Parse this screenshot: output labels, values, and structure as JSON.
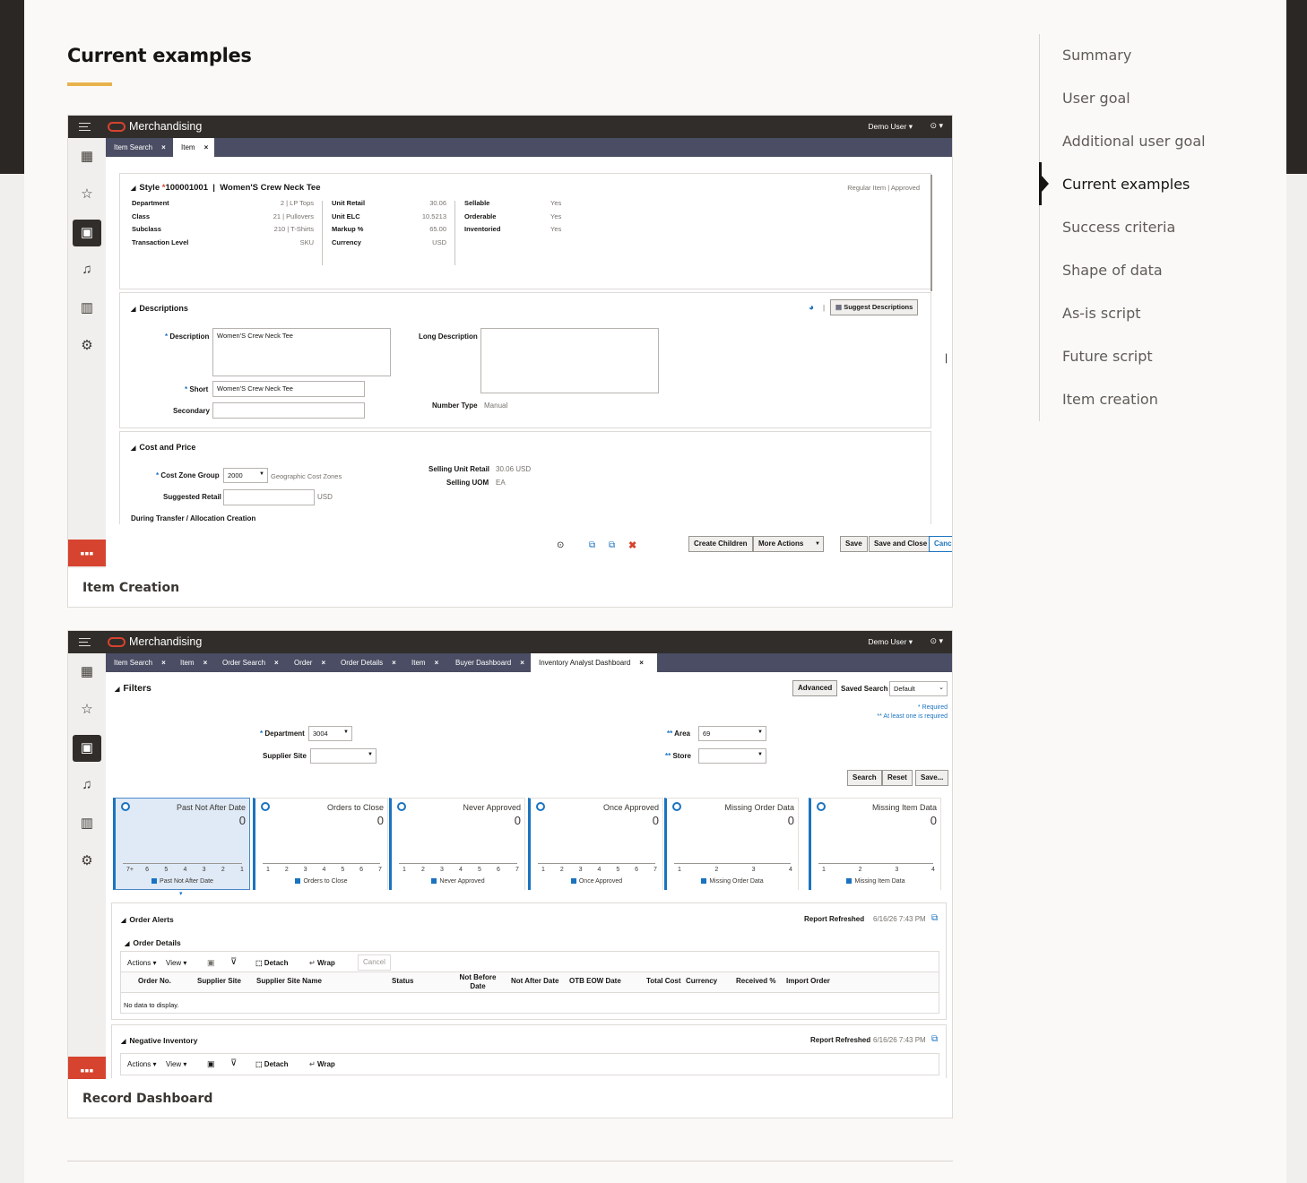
{
  "section_title": "Current examples",
  "toc": {
    "items": [
      "Summary",
      "User goal",
      "Additional user goal",
      "Current examples",
      "Success criteria",
      "Shape of data",
      "As-is script",
      "Future script",
      "Item creation"
    ],
    "active_index": 3
  },
  "screens": [
    {
      "caption": "Item Creation",
      "app": {
        "brand": "Merchandising",
        "user": "Demo User ▾",
        "help": "⊙ ▾"
      },
      "tabs": [
        {
          "label": "Item Search",
          "active": false
        },
        {
          "label": "Item",
          "active": true
        }
      ],
      "style_header": {
        "label": "Style",
        "id": "100001001",
        "name": "Women'S Crew Neck Tee",
        "status": "Regular Item  |  Approved"
      },
      "attrs_col1": [
        [
          "Department",
          "2 | LP Tops"
        ],
        [
          "Class",
          "21 | Pullovers"
        ],
        [
          "Subclass",
          "210 | T-Shirts"
        ],
        [
          "Transaction Level",
          "SKU"
        ]
      ],
      "attrs_col2": [
        [
          "Unit Retail",
          "30.06"
        ],
        [
          "Unit ELC",
          "10.5213"
        ],
        [
          "Markup %",
          "65.00"
        ],
        [
          "Currency",
          "USD"
        ]
      ],
      "attrs_col3": [
        [
          "Sellable",
          "Yes"
        ],
        [
          "Orderable",
          "Yes"
        ],
        [
          "Inventoried",
          "Yes"
        ]
      ],
      "descriptions": {
        "title": "Descriptions",
        "suggest_button": "Suggest Descriptions",
        "description_label": "Description",
        "description_value": "Women'S Crew Neck Tee",
        "short_label": "Short",
        "short_value": "Women'S Crew Neck Tee",
        "secondary_label": "Secondary",
        "long_label": "Long Description",
        "number_type_label": "Number Type",
        "number_type_value": "Manual"
      },
      "cost_price": {
        "title": "Cost and Price",
        "czg_label": "Cost Zone Group",
        "czg_value": "2000",
        "czg_desc": "Geographic Cost Zones",
        "suggested_retail_label": "Suggested Retail",
        "suggested_retail_unit": "USD",
        "selling_unit_retail_label": "Selling Unit Retail",
        "selling_unit_retail_value": "30.06  USD",
        "selling_uom_label": "Selling UOM",
        "selling_uom_value": "EA",
        "during_transfer": "During Transfer / Allocation Creation"
      },
      "footer_buttons": {
        "create_children": "Create Children",
        "more_actions": "More Actions",
        "save": "Save",
        "save_close": "Save and Close",
        "cancel": "Cancel"
      }
    },
    {
      "caption": "Record Dashboard",
      "app": {
        "brand": "Merchandising",
        "user": "Demo User ▾",
        "help": "⊙ ▾"
      },
      "tabs": [
        {
          "label": "Item Search",
          "active": false
        },
        {
          "label": "Item",
          "active": false
        },
        {
          "label": "Order Search",
          "active": false
        },
        {
          "label": "Order",
          "active": false
        },
        {
          "label": "Order Details",
          "active": false
        },
        {
          "label": "Item",
          "active": false
        },
        {
          "label": "Buyer Dashboard",
          "active": false
        },
        {
          "label": "Inventory Analyst Dashboard",
          "active": true
        }
      ],
      "filters": {
        "title": "Filters",
        "advanced": "Advanced",
        "saved_search_label": "Saved Search",
        "saved_search_value": "Default",
        "required_note": "* Required",
        "atleast_note": "** At least one is required",
        "department_label": "Department",
        "department_value": "3004",
        "supplier_site_label": "Supplier Site",
        "area_label": "Area",
        "area_value": "69",
        "store_label": "Store",
        "search": "Search",
        "reset": "Reset",
        "save": "Save..."
      },
      "tiles": [
        {
          "title": "Past Not After Date",
          "value": "0",
          "ticks": [
            "7+",
            "6",
            "5",
            "4",
            "3",
            "2",
            "1"
          ],
          "legend": "Past Not After Date",
          "selected": true
        },
        {
          "title": "Orders to Close",
          "value": "0",
          "ticks": [
            "1",
            "2",
            "3",
            "4",
            "5",
            "6",
            "7"
          ],
          "legend": "Orders to Close",
          "selected": false
        },
        {
          "title": "Never Approved",
          "value": "0",
          "ticks": [
            "1",
            "2",
            "3",
            "4",
            "5",
            "6",
            "7"
          ],
          "legend": "Never Approved",
          "selected": false
        },
        {
          "title": "Once Approved",
          "value": "0",
          "ticks": [
            "1",
            "2",
            "3",
            "4",
            "5",
            "6",
            "7"
          ],
          "legend": "Once Approved",
          "selected": false
        },
        {
          "title": "Missing Order Data",
          "value": "0",
          "ticks": [
            "1",
            "2",
            "3",
            "4"
          ],
          "legend": "Missing Order Data",
          "selected": false
        },
        {
          "title": "Missing Item Data",
          "value": "0",
          "ticks": [
            "1",
            "2",
            "3",
            "4"
          ],
          "legend": "Missing Item Data",
          "selected": false
        }
      ],
      "order_alerts": {
        "title": "Order Alerts",
        "refreshed_label": "Report Refreshed",
        "refreshed_value": "6/16/26 7:43 PM"
      },
      "order_details": {
        "title": "Order Details",
        "toolbar": {
          "actions": "Actions ▾",
          "view": "View ▾",
          "detach": "Detach",
          "wrap": "Wrap",
          "cancel": "Cancel"
        },
        "columns": [
          "Order No.",
          "Supplier Site",
          "Supplier Site Name",
          "Status",
          "Not Before Date",
          "Not After Date",
          "OTB EOW Date",
          "Total Cost",
          "Currency",
          "Received %",
          "Import Order"
        ],
        "empty": "No data to display."
      },
      "negative_inventory": {
        "title": "Negative Inventory",
        "refreshed_label": "Report Refreshed",
        "refreshed_value": "6/16/26 7:43 PM"
      }
    }
  ]
}
